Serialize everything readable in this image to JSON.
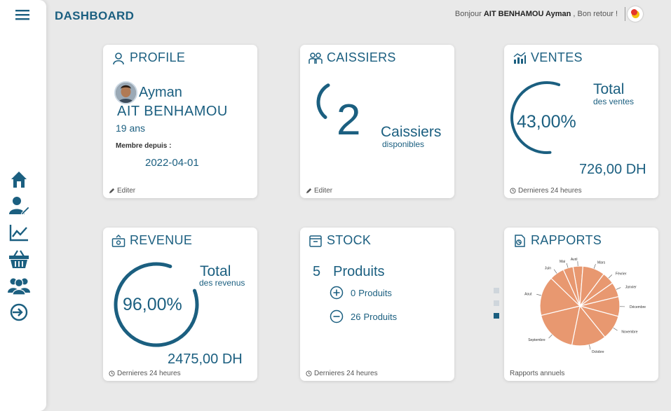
{
  "header": {
    "title": "DASHBOARD",
    "greeting_prefix": "Bonjour",
    "user_name": "AIT BENHAMOU Ayman",
    "greeting_suffix": ", Bon retour !"
  },
  "sidebar": {
    "items": [
      {
        "icon": "home-icon"
      },
      {
        "icon": "user-edit-icon"
      },
      {
        "icon": "chart-line-icon"
      },
      {
        "icon": "basket-icon"
      },
      {
        "icon": "users-group-icon"
      },
      {
        "icon": "sign-in-icon"
      }
    ]
  },
  "profile": {
    "title": "PROFILE",
    "first_name": "Ayman",
    "last_name": "AIT BENHAMOU",
    "age": "19 ans",
    "member_label": "Membre depuis :",
    "member_date": "2022-04-01",
    "edit_label": "Editer"
  },
  "caissiers": {
    "title": "CAISSIERS",
    "count": "2",
    "label": "Caissiers",
    "sublabel": "disponibles",
    "edit_label": "Editer",
    "progress": 0.3
  },
  "ventes": {
    "title": "VENTES",
    "total_label": "Total",
    "total_sub": "des ventes",
    "percent": "43,00%",
    "percent_value": 0.43,
    "amount": "726,00 DH",
    "footer": "Dernieres 24 heures"
  },
  "revenue": {
    "title": "REVENUE",
    "total_label": "Total",
    "total_sub": "des revenus",
    "percent": "96,00%",
    "percent_value": 0.96,
    "amount": "2475,00 DH",
    "footer": "Dernieres 24 heures"
  },
  "stock": {
    "title": "STOCK",
    "total_count": "5",
    "total_label": "Produits",
    "plus_count": "0",
    "plus_label": "Produits",
    "minus_count": "26",
    "minus_label": "Produits",
    "footer": "Dernieres 24 heures"
  },
  "rapports": {
    "title": "RAPPORTS",
    "footer": "Rapports annuels",
    "pie_labels": [
      "Avril",
      "Mars",
      "Février",
      "Janvier",
      "Décembre",
      "Novembre",
      "Octobre",
      "Septembre",
      "Aout",
      "Juin",
      "Mai"
    ],
    "pie_color": "#e89870"
  },
  "carousel": {
    "pages": 3,
    "active": 2
  },
  "colors": {
    "accent": "#1b5f80",
    "background": "#e9e9e9",
    "card": "#ffffff"
  }
}
